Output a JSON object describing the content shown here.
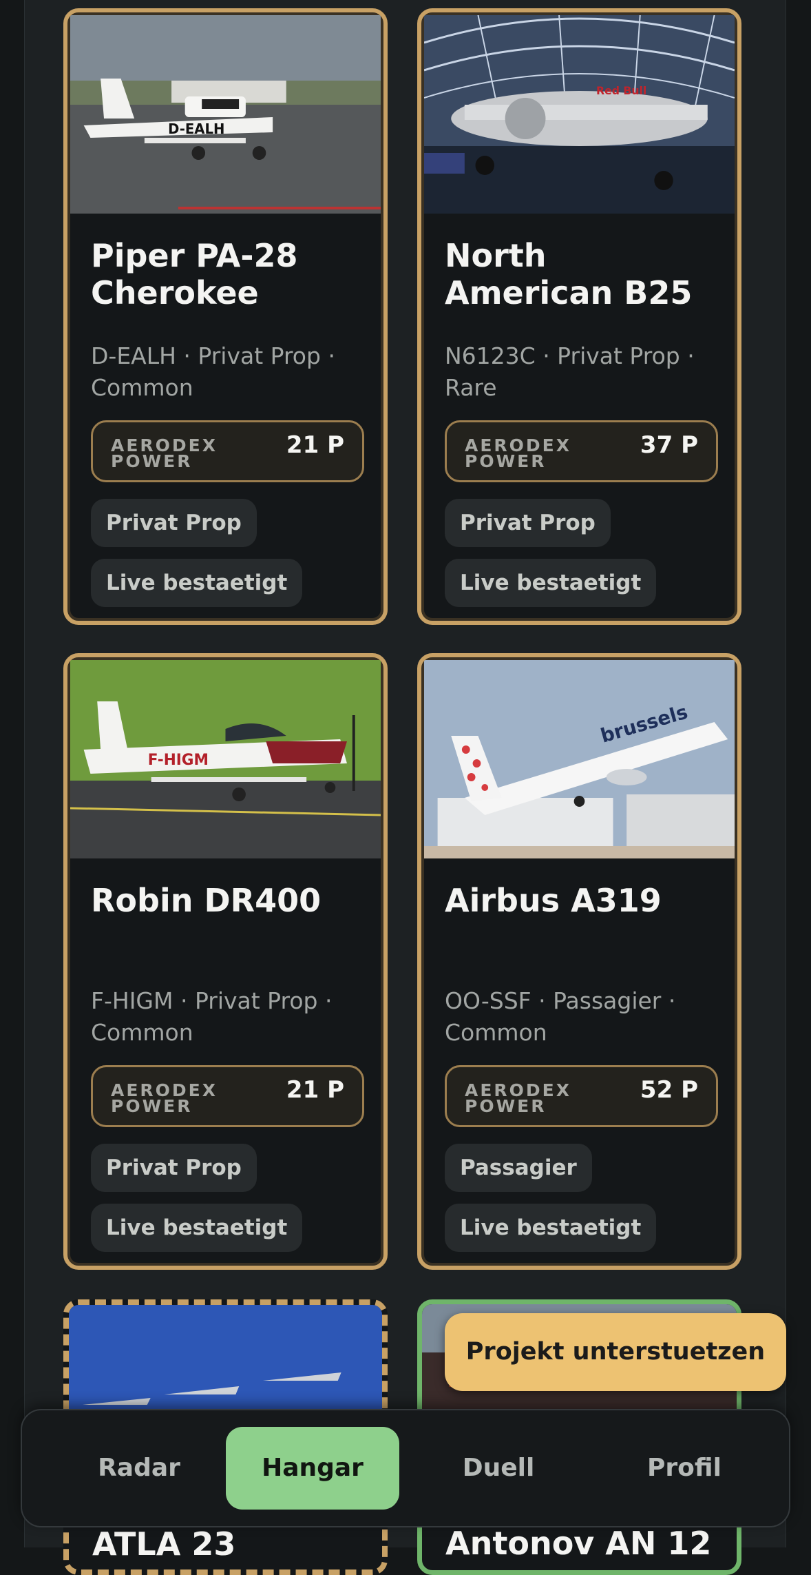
{
  "cards": [
    {
      "name": "Piper PA-28 Cherokee",
      "meta": "D-EALH · Privat Prop · Common",
      "power_label": "AERODEX POWER",
      "power_value": "21 P",
      "tags": [
        "Privat Prop",
        "Live bestaetigt"
      ],
      "image_text": "D-EALH"
    },
    {
      "name": "North American B25",
      "meta": "N6123C · Privat Prop · Rare",
      "power_label": "AERODEX POWER",
      "power_value": "37 P",
      "tags": [
        "Privat Prop",
        "Live bestaetigt"
      ],
      "image_text": "Red Bull"
    },
    {
      "name": "Robin DR400",
      "meta": "F-HIGM · Privat Prop · Common",
      "power_label": "AERODEX POWER",
      "power_value": "21 P",
      "tags": [
        "Privat Prop",
        "Live bestaetigt"
      ],
      "image_text": "F-HIGM"
    },
    {
      "name": "Airbus A319",
      "meta": "OO-SSF · Passagier · Common",
      "power_label": "AERODEX POWER",
      "power_value": "52 P",
      "tags": [
        "Passagier",
        "Live bestaetigt"
      ],
      "image_text": "brussels"
    }
  ],
  "partial_cards": [
    {
      "name": "ATLA 23"
    },
    {
      "name": "Antonov AN 12"
    }
  ],
  "support_button": {
    "label": "Projekt unterstuetzen"
  },
  "nav": {
    "tabs": [
      {
        "label": "Radar",
        "active": false
      },
      {
        "label": "Hangar",
        "active": true
      },
      {
        "label": "Duell",
        "active": false
      },
      {
        "label": "Profil",
        "active": false
      }
    ]
  },
  "colors": {
    "card_border": "#c8a165",
    "support_button": "#edc272",
    "active_tab": "#8ed08c",
    "partial_card_green": "#6fb56a"
  }
}
